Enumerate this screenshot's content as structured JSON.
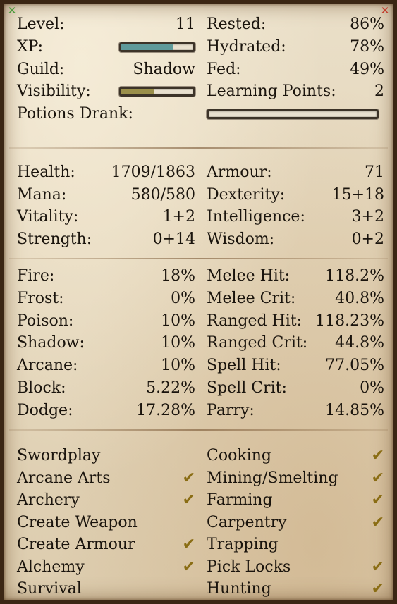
{
  "window": {
    "corner_left_icon": "expand-icon",
    "corner_right_icon": "close-icon"
  },
  "status": {
    "level_label": "Level:",
    "level_value": "11",
    "xp_label": "XP:",
    "xp_fill": 0.72,
    "xp_color": "#5f9a9a",
    "guild_label": "Guild:",
    "guild_value": "Shadow",
    "visibility_label": "Visibility:",
    "visibility_fill": 0.45,
    "visibility_color": "#9a8f4a",
    "potions_label": "Potions Drank:",
    "potions_fill": 0.0,
    "rested_label": "Rested:",
    "rested_value": "86%",
    "hydrated_label": "Hydrated:",
    "hydrated_value": "78%",
    "fed_label": "Fed:",
    "fed_value": "49%",
    "learning_label": "Learning Points:",
    "learning_value": "2"
  },
  "attributes": {
    "left": [
      {
        "label": "Health:",
        "value": "1709/1863"
      },
      {
        "label": "Mana:",
        "value": "580/580"
      },
      {
        "label": "Vitality:",
        "value": "1+2"
      },
      {
        "label": "Strength:",
        "value": "0+14"
      }
    ],
    "right": [
      {
        "label": "Armour:",
        "value": "71"
      },
      {
        "label": "Dexterity:",
        "value": "15+18"
      },
      {
        "label": "Intelligence:",
        "value": "3+2"
      },
      {
        "label": "Wisdom:",
        "value": "0+2"
      }
    ]
  },
  "combat": {
    "left": [
      {
        "label": "Fire:",
        "value": "18%"
      },
      {
        "label": "Frost:",
        "value": "0%"
      },
      {
        "label": "Poison:",
        "value": "10%"
      },
      {
        "label": "Shadow:",
        "value": "10%"
      },
      {
        "label": "Arcane:",
        "value": "10%"
      },
      {
        "label": "Block:",
        "value": "5.22%"
      },
      {
        "label": "Dodge:",
        "value": "17.28%"
      }
    ],
    "right": [
      {
        "label": "Melee Hit:",
        "value": "118.2%"
      },
      {
        "label": "Melee Crit:",
        "value": "40.8%"
      },
      {
        "label": "Ranged Hit:",
        "value": "118.23%"
      },
      {
        "label": "Ranged Crit:",
        "value": "44.8%"
      },
      {
        "label": "Spell Hit:",
        "value": "77.05%"
      },
      {
        "label": "Spell Crit:",
        "value": "0%"
      },
      {
        "label": "Parry:",
        "value": "14.85%"
      }
    ]
  },
  "skills": {
    "check_glyph": "✔",
    "left": [
      {
        "label": "Swordplay",
        "learned": false
      },
      {
        "label": "Arcane Arts",
        "learned": true
      },
      {
        "label": "Archery",
        "learned": true
      },
      {
        "label": "Create Weapon",
        "learned": false
      },
      {
        "label": "Create Armour",
        "learned": true
      },
      {
        "label": "Alchemy",
        "learned": true
      },
      {
        "label": "Survival",
        "learned": false
      }
    ],
    "right": [
      {
        "label": "Cooking",
        "learned": true
      },
      {
        "label": "Mining/Smelting",
        "learned": true
      },
      {
        "label": "Farming",
        "learned": true
      },
      {
        "label": "Carpentry",
        "learned": true
      },
      {
        "label": "Trapping",
        "learned": false
      },
      {
        "label": "Pick Locks",
        "learned": true
      },
      {
        "label": "Hunting",
        "learned": true
      }
    ]
  }
}
